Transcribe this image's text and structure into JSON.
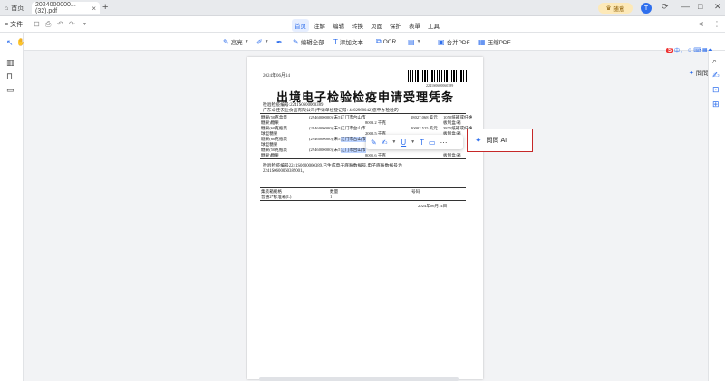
{
  "tabbar": {
    "home_label": "首页",
    "doc_tab_label": "2024000000...(32).pdf",
    "close_glyph": "×",
    "new_tab_glyph": "+",
    "upgrade_label": "随意",
    "avatar_letter": "T"
  },
  "menubar": {
    "file_label": "文件",
    "tabs": [
      "首页",
      "注解",
      "编辑",
      "转换",
      "页面",
      "保护",
      "表單",
      "工具"
    ],
    "active_tab": "首页"
  },
  "toolbar": {
    "items": [
      "高亮",
      "",
      "编辑全部",
      "添加文本",
      "OCR",
      "",
      "合并PDF",
      "压缩PDF"
    ]
  },
  "right_panel": {
    "ask_ai_tab_label": "問問 AI",
    "ime_items": [
      "S",
      "中",
      "。"
    ]
  },
  "document": {
    "date": "2024年06月14",
    "barcode_number": "2241S0600060389",
    "title": "出境电子检验检疫申请受理凭条",
    "line1": "检验检疫编号:2241S0600060389",
    "line2": "广东卓佳农业食品有限公司(申请单位登记号: 4402968042)您申办检验的",
    "rows": [
      {
        "c1": "糖果(50克盒装",
        "c1b": "糖果)糖果",
        "c2": "(2946000000)(未5)",
        "c3": "江门市台山市",
        "c4": "8003.2 千克",
        "c5": "18027.068 美元",
        "c6": "1050纸箱或纤维",
        "c6b": "板制盒/箱"
      },
      {
        "c1": "糖果(60克瓶装",
        "c1b": "球型糖果",
        "c2": "(2946000000)(未5)",
        "c3": "江门市台山市",
        "c4": "2002.5 千克",
        "c5": "20002.525 美元",
        "c6": "3875纸箱或纤维",
        "c6b": "板制盒/箱"
      },
      {
        "c1": "糖果(60克瓶装",
        "c1b": "球型糖果",
        "c2": "(2946000000)(未5)",
        "c3": "江门市台山市",
        "c4": "",
        "c5": "",
        "c6": "",
        "c6b": "板制盒/箱"
      },
      {
        "c1": "糖果(50克瓶装",
        "c1b": "糖果)糖果",
        "c2": "(2946000000)(未5)",
        "c3": "江门市台山市",
        "c4": "8005.6 千克",
        "c5": "",
        "c6": "",
        "c6b": "板制盒/箱"
      }
    ],
    "note1": "检验检疫编号2241S0600060389,已生成电子底账数据号,电子底账数据号为",
    "note2": "2241S0600060389001。",
    "table2_headers": [
      "集装箱规格",
      "数量",
      "号码"
    ],
    "table2_row": [
      "普通2*标准箱(L)",
      "1",
      ""
    ],
    "footer_date": "2024年06月14日"
  },
  "float_toolbar": {
    "icons": [
      "edit-icon",
      "sign-icon",
      "underline-icon",
      "text-icon",
      "comment-icon",
      "more-icon"
    ]
  },
  "ask_ai_popup": {
    "label": "問問 AI"
  }
}
